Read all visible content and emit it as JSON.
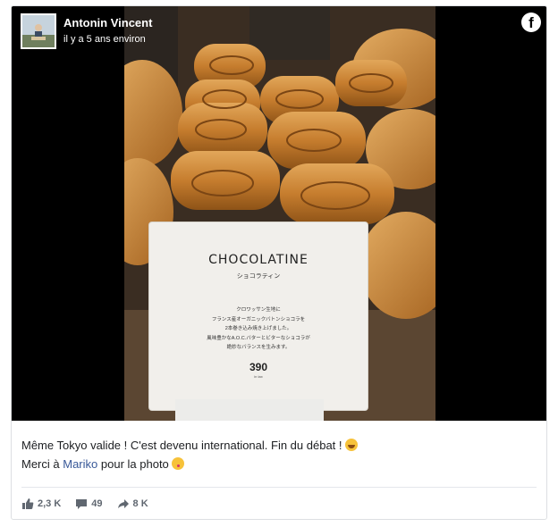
{
  "post": {
    "author": "Antonin Vincent",
    "timestamp": "il y a 5 ans environ",
    "platform_icon": "facebook-icon"
  },
  "photo": {
    "sign_title": "CHOCOLATINE",
    "sign_subtitle": "ショコラティン",
    "sign_body": [
      "クロワッサン生地に",
      "フランス産オーガニックバトンショコラを",
      "2本巻き込み焼き上げました。",
      "風味豊かなA.O.C.バターとビターなショコラが",
      "絶妙なバランスを生みます。"
    ],
    "price": "390",
    "tax_note": "in tax"
  },
  "caption": {
    "line1": "Même Tokyo valide ! C'est devenu international. Fin du débat !",
    "line2_prefix": "Merci à",
    "line2_mention": "Mariko",
    "line2_suffix": "pour la photo"
  },
  "stats": {
    "likes": "2,3 K",
    "comments": "49",
    "shares": "8 K"
  },
  "colors": {
    "mention": "#385898",
    "stat_text": "#606770"
  }
}
